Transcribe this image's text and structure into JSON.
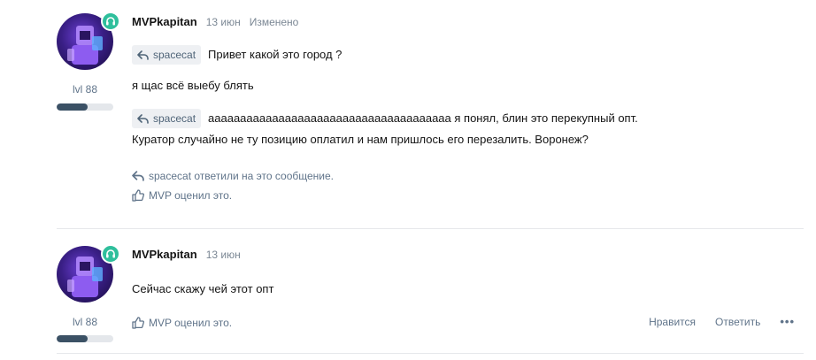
{
  "posts": [
    {
      "author": "MVPkapitan",
      "date": "13 июн",
      "edited": "Изменено",
      "level": "lvl 88",
      "level_progress": 0.55,
      "lines": [
        {
          "quote": "spacecat",
          "text": "Привет какой это город ?"
        },
        {
          "quote": "",
          "text": "я щас всё выебу блять"
        },
        {
          "quote": "spacecat",
          "text": "аааааааааааааааааааааааааааааааааааааа я понял, блин это перекупный опт."
        },
        {
          "quote": "",
          "text": "Куратор случайно не ту позицию оплатил и нам пришлось его перезалить. Воронеж?"
        }
      ],
      "replied": "spacecat ответили на это сообщение.",
      "liked": "MVP оценил это."
    },
    {
      "author": "MVPkapitan",
      "date": "13 июн",
      "level": "lvl 88",
      "level_progress": 0.55,
      "text": "Сейчас скажу чей этот опт",
      "liked": "MVP оценил это.",
      "actions": {
        "like": "Нравится",
        "reply": "Ответить",
        "more": "•••"
      }
    }
  ],
  "colors": {
    "badge": "#2fbf9c",
    "chip_bg": "#eef0f3",
    "muted": "#60748a",
    "bar_fill": "#3b5165"
  }
}
